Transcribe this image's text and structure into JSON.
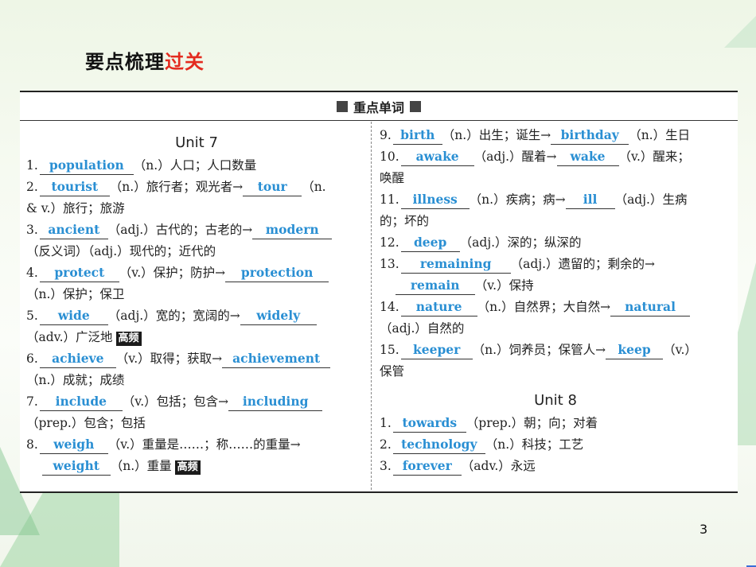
{
  "heading": {
    "black": "要点梳理",
    "red": "过关"
  },
  "panel_title": "重点单词",
  "tag_high": "高频",
  "page_number": "3",
  "unit7": {
    "title": "Unit 7",
    "entries": [
      {
        "n": "1.",
        "a1": "population",
        "t1": "（n.）人口；人口数量"
      },
      {
        "n": "2.",
        "a1": "tourist",
        "t1": "（n.）旅行者；观光者→",
        "a2": "tour",
        "t2": "（n.",
        "l2": "& v.）旅行；旅游"
      },
      {
        "n": "3.",
        "a1": "ancient",
        "t1": "（adj.）古代的；古老的→",
        "a2": "modern",
        "l2": "（反义词）（adj.）现代的；近代的"
      },
      {
        "n": "4.",
        "a1": "protect",
        "t1": "（v.）保护；防护→",
        "a2": "protection",
        "l2": "（n.）保护；保卫"
      },
      {
        "n": "5.",
        "a1": "wide",
        "t1": "（adj.）宽的；宽阔的→",
        "a2": "widely",
        "l2": "（adv.）广泛地"
      },
      {
        "n": "6.",
        "a1": "achieve",
        "t1": "（v.）取得；获取→",
        "a2": "achievement",
        "l2": "（n.）成就；成绩"
      },
      {
        "n": "7.",
        "a1": "include",
        "t1": "（v.）包括；包含→",
        "a2": "including",
        "l2": "（prep.）包含；包括"
      },
      {
        "n": "8.",
        "a1": "weigh",
        "t1": "（v.）重量是……；称……的重量→",
        "a2": "weight",
        "t2": "（n.）重量"
      }
    ]
  },
  "unit7_right": {
    "entries": [
      {
        "n": "9.",
        "a1": "birth",
        "t1": "（n.）出生；诞生→",
        "a2": "birthday",
        "t2": "（n.）生日"
      },
      {
        "n": "10.",
        "a1": "awake",
        "t1": "（adj.）醒着→",
        "a2": "wake",
        "t2": "（v.）醒来；",
        "l2": "唤醒"
      },
      {
        "n": "11.",
        "a1": "illness",
        "t1": "（n.）疾病；病→",
        "a2": "ill",
        "t2": "（adj.）生病",
        "l2": "的；坏的"
      },
      {
        "n": "12.",
        "a1": "deep",
        "t1": "（adj.）深的；纵深的"
      },
      {
        "n": "13.",
        "a1": "remaining",
        "t1": "（adj.）遗留的；剩余的→",
        "a2": "remain",
        "t2": "（v.）保持"
      },
      {
        "n": "14.",
        "a1": "nature",
        "t1": "（n.）自然界；大自然→",
        "a2": "natural",
        "l2": "（adj.）自然的"
      },
      {
        "n": "15.",
        "a1": "keeper",
        "t1": "（n.）饲养员；保管人→",
        "a2": "keep",
        "t2": "（v.）",
        "l2": "保管"
      }
    ]
  },
  "unit8": {
    "title": "Unit 8",
    "entries": [
      {
        "n": "1.",
        "a1": "towards",
        "t1": "（prep.）朝；向；对着"
      },
      {
        "n": "2.",
        "a1": "technology",
        "t1": "（n.）科技；工艺"
      },
      {
        "n": "3.",
        "a1": "forever",
        "t1": "（adv.）永远"
      }
    ]
  }
}
